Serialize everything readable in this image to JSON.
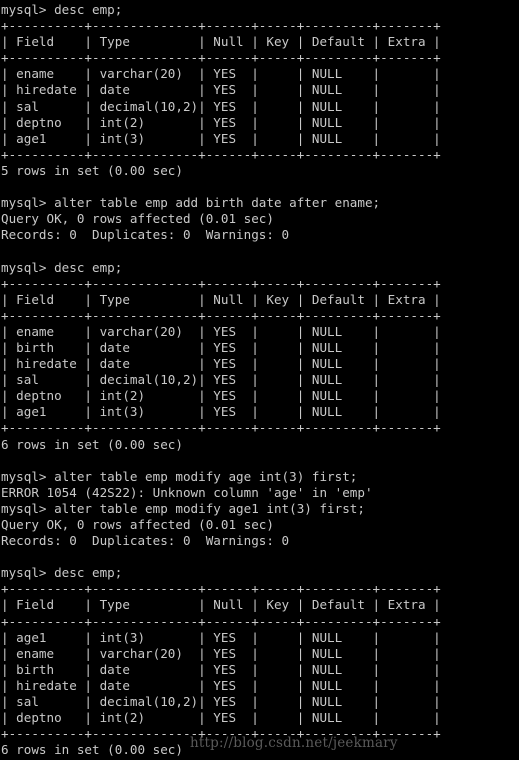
{
  "terminal": {
    "prompt": "mysql>",
    "background_color": "#000000",
    "text_color": "#c9c9c9",
    "watermark": {
      "text": "http://blog.csdn.net/jeekmary",
      "color": "#5a5a5a"
    },
    "lines": [
      "mysql> desc emp;",
      "+----------+--------------+------+-----+---------+-------+",
      "| Field    | Type         | Null | Key | Default | Extra |",
      "+----------+--------------+------+-----+---------+-------+",
      "| ename    | varchar(20)  | YES  |     | NULL    |       |",
      "| hiredate | date         | YES  |     | NULL    |       |",
      "| sal      | decimal(10,2)| YES  |     | NULL    |       |",
      "| deptno   | int(2)       | YES  |     | NULL    |       |",
      "| age1     | int(3)       | YES  |     | NULL    |       |",
      "+----------+--------------+------+-----+---------+-------+",
      "5 rows in set (0.00 sec)",
      "",
      "mysql> alter table emp add birth date after ename;",
      "Query OK, 0 rows affected (0.01 sec)",
      "Records: 0  Duplicates: 0  Warnings: 0",
      "",
      "mysql> desc emp;",
      "+----------+--------------+------+-----+---------+-------+",
      "| Field    | Type         | Null | Key | Default | Extra |",
      "+----------+--------------+------+-----+---------+-------+",
      "| ename    | varchar(20)  | YES  |     | NULL    |       |",
      "| birth    | date         | YES  |     | NULL    |       |",
      "| hiredate | date         | YES  |     | NULL    |       |",
      "| sal      | decimal(10,2)| YES  |     | NULL    |       |",
      "| deptno   | int(2)       | YES  |     | NULL    |       |",
      "| age1     | int(3)       | YES  |     | NULL    |       |",
      "+----------+--------------+------+-----+---------+-------+",
      "6 rows in set (0.00 sec)",
      "",
      "mysql> alter table emp modify age int(3) first;",
      "ERROR 1054 (42S22): Unknown column 'age' in 'emp'",
      "mysql> alter table emp modify age1 int(3) first;",
      "Query OK, 0 rows affected (0.01 sec)",
      "Records: 0  Duplicates: 0  Warnings: 0",
      "",
      "mysql> desc emp;",
      "+----------+--------------+------+-----+---------+-------+",
      "| Field    | Type         | Null | Key | Default | Extra |",
      "+----------+--------------+------+-----+---------+-------+",
      "| age1     | int(3)       | YES  |     | NULL    |       |",
      "| ename    | varchar(20)  | YES  |     | NULL    |       |",
      "| birth    | date         | YES  |     | NULL    |       |",
      "| hiredate | date         | YES  |     | NULL    |       |",
      "| sal      | decimal(10,2)| YES  |     | NULL    |       |",
      "| deptno   | int(2)       | YES  |     | NULL    |       |",
      "+----------+--------------+------+-----+---------+-------+",
      "6 rows in set (0.00 sec)"
    ],
    "commands": [
      "desc emp;",
      "alter table emp add birth date after ename;",
      "desc emp;",
      "alter table emp modify age int(3) first;",
      "alter table emp modify age1 int(3) first;",
      "desc emp;"
    ],
    "results": [
      {
        "name": "desc-emp-result-1",
        "columns": [
          "Field",
          "Type",
          "Null",
          "Key",
          "Default",
          "Extra"
        ],
        "rows": [
          [
            "ename",
            "varchar(20)",
            "YES",
            "",
            "NULL",
            ""
          ],
          [
            "hiredate",
            "date",
            "YES",
            "",
            "NULL",
            ""
          ],
          [
            "sal",
            "decimal(10,2)",
            "YES",
            "",
            "NULL",
            ""
          ],
          [
            "deptno",
            "int(2)",
            "YES",
            "",
            "NULL",
            ""
          ],
          [
            "age1",
            "int(3)",
            "YES",
            "",
            "NULL",
            ""
          ]
        ],
        "footer": "5 rows in set (0.00 sec)"
      },
      {
        "name": "alter-add-birth-result",
        "status": "Query OK, 0 rows affected (0.01 sec)",
        "detail": "Records: 0  Duplicates: 0  Warnings: 0"
      },
      {
        "name": "desc-emp-result-2",
        "columns": [
          "Field",
          "Type",
          "Null",
          "Key",
          "Default",
          "Extra"
        ],
        "rows": [
          [
            "ename",
            "varchar(20)",
            "YES",
            "",
            "NULL",
            ""
          ],
          [
            "birth",
            "date",
            "YES",
            "",
            "NULL",
            ""
          ],
          [
            "hiredate",
            "date",
            "YES",
            "",
            "NULL",
            ""
          ],
          [
            "sal",
            "decimal(10,2)",
            "YES",
            "",
            "NULL",
            ""
          ],
          [
            "deptno",
            "int(2)",
            "YES",
            "",
            "NULL",
            ""
          ],
          [
            "age1",
            "int(3)",
            "YES",
            "",
            "NULL",
            ""
          ]
        ],
        "footer": "6 rows in set (0.00 sec)"
      },
      {
        "name": "alter-modify-age-error",
        "error": "ERROR 1054 (42S22): Unknown column 'age' in 'emp'"
      },
      {
        "name": "alter-modify-age1-result",
        "status": "Query OK, 0 rows affected (0.01 sec)",
        "detail": "Records: 0  Duplicates: 0  Warnings: 0"
      },
      {
        "name": "desc-emp-result-3",
        "columns": [
          "Field",
          "Type",
          "Null",
          "Key",
          "Default",
          "Extra"
        ],
        "rows": [
          [
            "age1",
            "int(3)",
            "YES",
            "",
            "NULL",
            ""
          ],
          [
            "ename",
            "varchar(20)",
            "YES",
            "",
            "NULL",
            ""
          ],
          [
            "birth",
            "date",
            "YES",
            "",
            "NULL",
            ""
          ],
          [
            "hiredate",
            "date",
            "YES",
            "",
            "NULL",
            ""
          ],
          [
            "sal",
            "decimal(10,2)",
            "YES",
            "",
            "NULL",
            ""
          ],
          [
            "deptno",
            "int(2)",
            "YES",
            "",
            "NULL",
            ""
          ]
        ],
        "footer": "6 rows in set (0.00 sec)"
      }
    ]
  }
}
